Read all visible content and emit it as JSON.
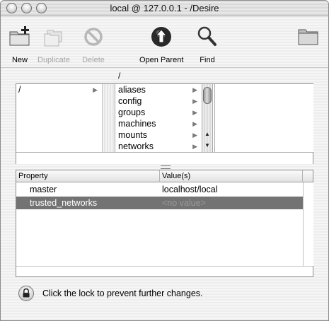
{
  "window": {
    "title": "local @ 127.0.0.1 - /Desire"
  },
  "toolbar": {
    "new_label": "New",
    "duplicate_label": "Duplicate",
    "delete_label": "Delete",
    "open_parent_label": "Open Parent",
    "find_label": "Find"
  },
  "browser": {
    "path": "/",
    "column1": [
      "/"
    ],
    "column2": [
      "aliases",
      "config",
      "groups",
      "machines",
      "mounts",
      "networks"
    ]
  },
  "properties": {
    "headers": {
      "property": "Property",
      "values": "Value(s)"
    },
    "rows": [
      {
        "property": "master",
        "value": "localhost/local"
      },
      {
        "property": "trusted_networks",
        "value": "<no value>"
      }
    ]
  },
  "status": {
    "lock_text": "Click the lock to prevent further changes."
  },
  "colors": {
    "selection": "#737373",
    "disabled_text": "#a5a5a5"
  }
}
